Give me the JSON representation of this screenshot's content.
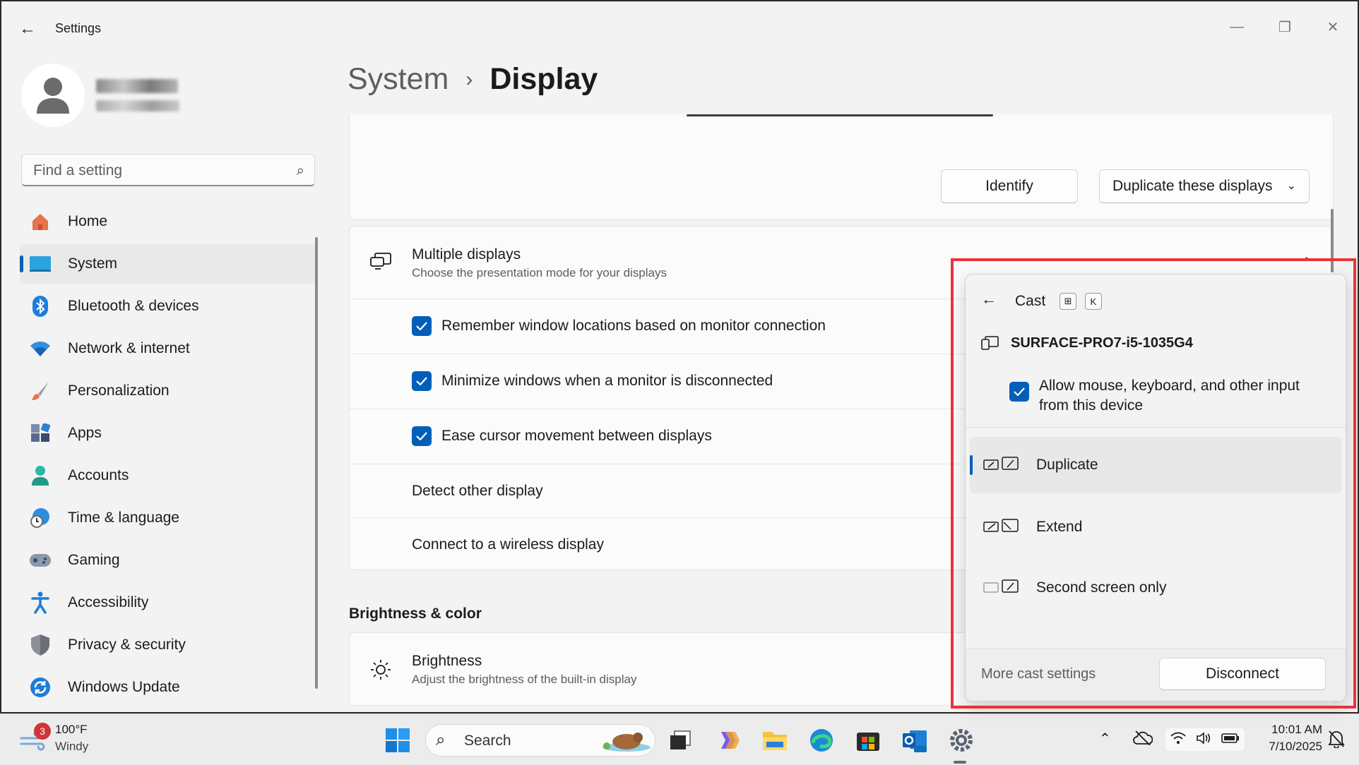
{
  "window": {
    "app_title": "Settings",
    "controls": {
      "minimize": "—",
      "restore": "❐",
      "close": "✕"
    }
  },
  "sidebar": {
    "search": {
      "placeholder": "Find a setting"
    },
    "items": [
      {
        "label": "Home",
        "icon": "home-icon"
      },
      {
        "label": "System",
        "icon": "system-icon",
        "active": true
      },
      {
        "label": "Bluetooth & devices",
        "icon": "bluetooth-icon"
      },
      {
        "label": "Network & internet",
        "icon": "wifi-icon"
      },
      {
        "label": "Personalization",
        "icon": "brush-icon"
      },
      {
        "label": "Apps",
        "icon": "apps-icon"
      },
      {
        "label": "Accounts",
        "icon": "person-icon"
      },
      {
        "label": "Time & language",
        "icon": "clock-globe-icon"
      },
      {
        "label": "Gaming",
        "icon": "gamepad-icon"
      },
      {
        "label": "Accessibility",
        "icon": "accessibility-icon"
      },
      {
        "label": "Privacy & security",
        "icon": "shield-icon"
      },
      {
        "label": "Windows Update",
        "icon": "update-icon"
      }
    ]
  },
  "main": {
    "breadcrumb": {
      "parent": "System",
      "separator": "›",
      "current": "Display"
    },
    "top_card": {
      "identify_label": "Identify",
      "mode_dropdown": "Duplicate these displays"
    },
    "multiple_displays": {
      "title": "Multiple displays",
      "subtitle": "Choose the presentation mode for your displays",
      "options": [
        {
          "label": "Remember window locations based on monitor connection",
          "checked": true
        },
        {
          "label": "Minimize windows when a monitor is disconnected",
          "checked": true
        },
        {
          "label": "Ease cursor movement between displays",
          "checked": true
        }
      ],
      "detect_label": "Detect other display",
      "wireless_label": "Connect to a wireless display"
    },
    "brightness_section": {
      "heading": "Brightness & color",
      "title": "Brightness",
      "subtitle": "Adjust the brightness of the built-in display"
    }
  },
  "cast_flyout": {
    "title": "Cast",
    "shortcut_keys": [
      "⊞",
      "K"
    ],
    "device_name": "SURFACE-PRO7-i5-1035G4",
    "allow_input": {
      "label_line1": "Allow mouse, keyboard, and other input",
      "label_line2": "from this device",
      "checked": true
    },
    "modes": [
      {
        "label": "Duplicate",
        "selected": true
      },
      {
        "label": "Extend",
        "selected": false
      },
      {
        "label": "Second screen only",
        "selected": false
      }
    ],
    "more_settings": "More cast settings",
    "disconnect_label": "Disconnect"
  },
  "taskbar": {
    "weather": {
      "badge": "3",
      "temp": "100°F",
      "condition": "Windy"
    },
    "search_label": "Search",
    "clock": {
      "time": "10:01 AM",
      "date": "7/10/2025"
    }
  },
  "colors": {
    "accent": "#005fb8",
    "highlight": "#e8343a"
  }
}
